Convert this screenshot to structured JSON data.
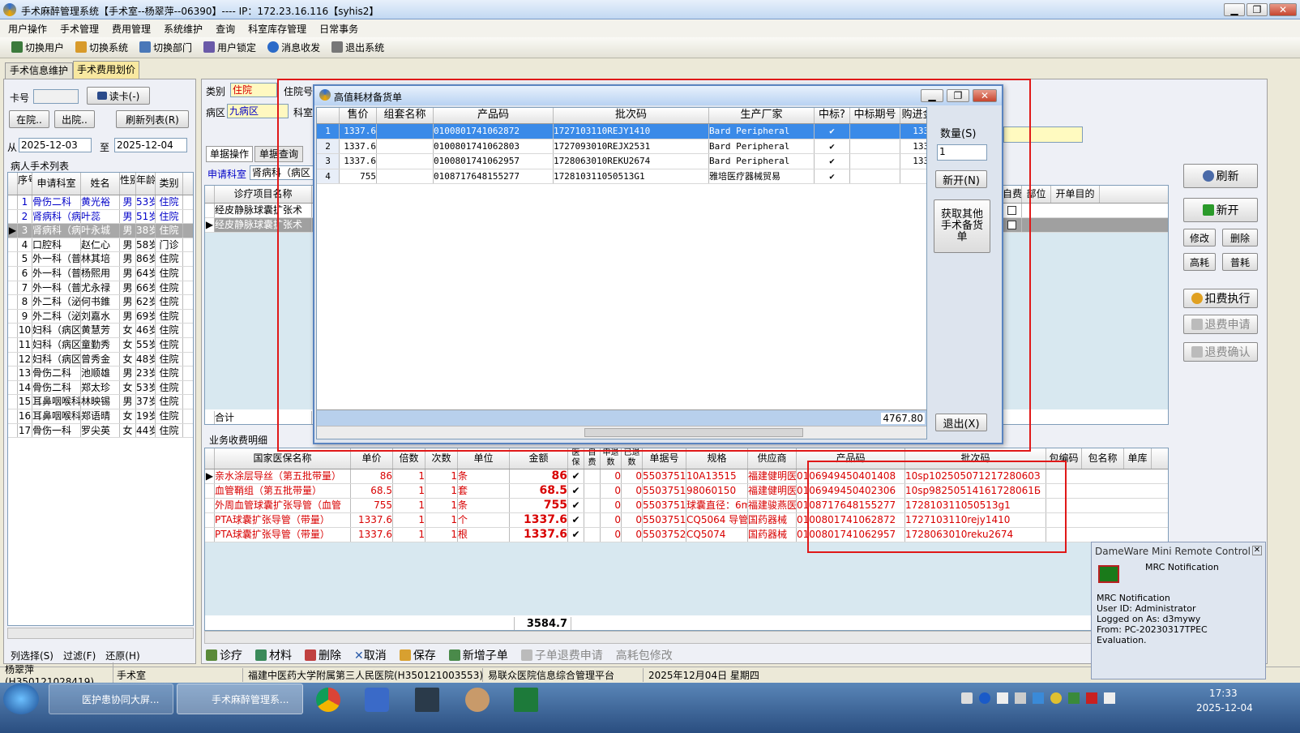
{
  "window": {
    "title": "手术麻醉管理系统【手术室--杨翠萍--06390】---- IP：172.23.16.116【syhis2】"
  },
  "menu": [
    "用户操作",
    "手术管理",
    "费用管理",
    "系统维护",
    "查询",
    "科室库存管理",
    "日常事务"
  ],
  "toolbar": [
    "切换用户",
    "切换系统",
    "切换部门",
    "用户锁定",
    "消息收发",
    "退出系统"
  ],
  "tabs": [
    "手术信息维护",
    "手术费用划价"
  ],
  "left": {
    "card_label": "卡号",
    "read_card": "读卡(-)",
    "in_hospital": "在院..",
    "out_hospital": "出院..",
    "refresh_list": "刷新列表(R)",
    "from_label": "从",
    "from_date": "2025-12-03",
    "to_label": "至",
    "to_date": "2025-12-04",
    "patient_list_title": "病人手术列表",
    "cols": [
      "序号",
      "申请科室",
      "姓名",
      "性别",
      "年龄",
      "类别"
    ],
    "patients": [
      [
        "1",
        "骨伤二科",
        "黄光裕",
        "男",
        "53岁",
        "住院"
      ],
      [
        "2",
        "肾病科（病",
        "叶蕊",
        "男",
        "51岁",
        "住院"
      ],
      [
        "3",
        "肾病科（病",
        "叶永城",
        "男",
        "38岁",
        "住院"
      ],
      [
        "4",
        "口腔科",
        "赵仁心",
        "男",
        "58岁",
        "门诊"
      ],
      [
        "5",
        "外一科（普",
        "林其培",
        "男",
        "86岁",
        "住院"
      ],
      [
        "6",
        "外一科（普",
        "杨熙用",
        "男",
        "64岁",
        "住院"
      ],
      [
        "7",
        "外一科（普",
        "尤永禄",
        "男",
        "66岁",
        "住院"
      ],
      [
        "8",
        "外二科（泌",
        "何书錐",
        "男",
        "62岁",
        "住院"
      ],
      [
        "9",
        "外二科（泌",
        "刘嘉水",
        "男",
        "69岁",
        "住院"
      ],
      [
        "10",
        "妇科（病区",
        "黄慧芳",
        "女",
        "46岁",
        "住院"
      ],
      [
        "11",
        "妇科（病区",
        "童勤秀",
        "女",
        "55岁",
        "住院"
      ],
      [
        "12",
        "妇科（病区",
        "曾秀金",
        "女",
        "48岁",
        "住院"
      ],
      [
        "13",
        "骨伤二科",
        "池顺雄",
        "男",
        "23岁",
        "住院"
      ],
      [
        "14",
        "骨伤二科",
        "郑太珍",
        "女",
        "53岁",
        "住院"
      ],
      [
        "15",
        "耳鼻咽喉科",
        "林映锡",
        "男",
        "37岁",
        "住院"
      ],
      [
        "16",
        "耳鼻咽喉科",
        "郑语晴",
        "女",
        "19岁",
        "住院"
      ],
      [
        "17",
        "骨伤一科",
        "罗尖英",
        "女",
        "44岁",
        "住院"
      ]
    ],
    "bottom": [
      "列选择(S)",
      "过滤(F)",
      "还原(H)"
    ]
  },
  "info": {
    "type_label": "类别",
    "type_value": "住院",
    "inpatient_label": "住院号",
    "ward_label": "病区",
    "ward_value": "九病区",
    "dept_label": "科室"
  },
  "doc_tabs": [
    "单据操作",
    "单据查询"
  ],
  "apply_dept_label": "申请科室",
  "apply_dept_value": "肾病科（病区",
  "items_grid": {
    "col": "诊疗项目名称",
    "rows": [
      "经皮静脉球囊扩张术",
      "经皮静脉球囊扩张术"
    ],
    "total_label": "合计"
  },
  "right_panel": {
    "extra_cols": [
      "自费",
      "部位",
      "开单目的"
    ],
    "buttons": [
      "刷新",
      "新开",
      "修改",
      "删除",
      "高耗",
      "普耗",
      "扣费执行",
      "退费申请",
      "退费确认"
    ]
  },
  "business": {
    "title": "业务收费明细",
    "cols": [
      "国家医保名称",
      "单价",
      "倍数",
      "次数",
      "单位",
      "金额",
      "医保",
      "自费",
      "申退数",
      "已退数",
      "单据号",
      "规格",
      "供应商",
      "产品码",
      "批次码",
      "包编码",
      "包名称",
      "单库"
    ],
    "rows": [
      [
        "亲水涂层导丝（第五批带量）",
        "86",
        "1",
        "1",
        "条",
        "86",
        "✔",
        "",
        "0",
        "0",
        "55037516",
        "10A13515",
        "福建健明医",
        "0106949450401408",
        "10sp10250507121728060З"
      ],
      [
        "血管鞘组（第五批带量）",
        "68.5",
        "1",
        "1",
        "套",
        "68.5",
        "✔",
        "",
        "0",
        "0",
        "55037517",
        "98060150",
        "福建健明医",
        "0106949450402306",
        "10sp98250514161728061Б"
      ],
      [
        "外周血管球囊扩张导管（血管",
        "755",
        "1",
        "1",
        "条",
        "755",
        "✔",
        "",
        "0",
        "0",
        "55037518",
        "球囊直径：6m",
        "福建骏燕医",
        "0108717648155277",
        "172810311050513g1"
      ],
      [
        "PTA球囊扩张导管（带量）",
        "1337.6",
        "1",
        "1",
        "个",
        "1337.6",
        "✔",
        "",
        "0",
        "0",
        "55037519",
        "CQ5064 导管",
        "国药器械",
        "0100801741062872",
        "1727103110rejy1410"
      ],
      [
        "PTA球囊扩张导管（带量）",
        "1337.6",
        "1",
        "1",
        "根",
        "1337.6",
        "✔",
        "",
        "0",
        "0",
        "55037520",
        "CQ5074",
        "国药器械",
        "0100801741062957",
        "1728063010reku2674"
      ]
    ],
    "total": "3584.7"
  },
  "action_bar": [
    "诊疗",
    "材料",
    "删除",
    "取消",
    "保存",
    "新增子单",
    "子单退费申请",
    "高耗包修改"
  ],
  "status_bar": [
    "杨翠萍(H350121028419)",
    "手术室",
    "福建中医药大学附属第三人民医院(H350121003553)",
    "易联众医院信息综合管理平台",
    "2025年12月04日 星期四"
  ],
  "dialog": {
    "title": "高值耗材备货单",
    "cols": [
      "售价",
      "组套名称",
      "产品码",
      "批次码",
      "生产厂家",
      "中标?",
      "中标期号",
      "购进金额"
    ],
    "rows": [
      [
        "1",
        "1337.6",
        "",
        "0100801741062872",
        "1727103110REJY1410",
        "Bard Peripheral",
        "✔",
        "",
        "1337.6"
      ],
      [
        "2",
        "1337.6",
        "",
        "0100801741062803",
        "1727093010REJX2531",
        "Bard Peripheral",
        "✔",
        "",
        "1337.6"
      ],
      [
        "3",
        "1337.6",
        "",
        "0100801741062957",
        "1728063010REKU2674",
        "Bard Peripheral",
        "✔",
        "",
        "1337.6"
      ],
      [
        "4",
        "755",
        "",
        "0108717648155277",
        "172810311050513G1",
        "雅培医疗器械贸易",
        "✔",
        "",
        "755"
      ]
    ],
    "footer_total": "4767.80",
    "qty_label": "数量(S)",
    "qty_value": "1",
    "new_button": "新开(N)",
    "fetch_button": "获取其他手术备货单",
    "exit_button": "退出(X)"
  },
  "notify": {
    "title": "DameWare Mini Remote Control",
    "heading": "MRC Notification",
    "lines": [
      "MRC Notification",
      "User ID: Administrator",
      "Logged on As: d3mywy",
      "From: PC-20230317TPEC",
      "Evaluation."
    ]
  },
  "taskbar": {
    "items": [
      "医护患协同大屏...",
      "手术麻醉管理系..."
    ],
    "time": "17:33",
    "date": "2025-12-04"
  }
}
